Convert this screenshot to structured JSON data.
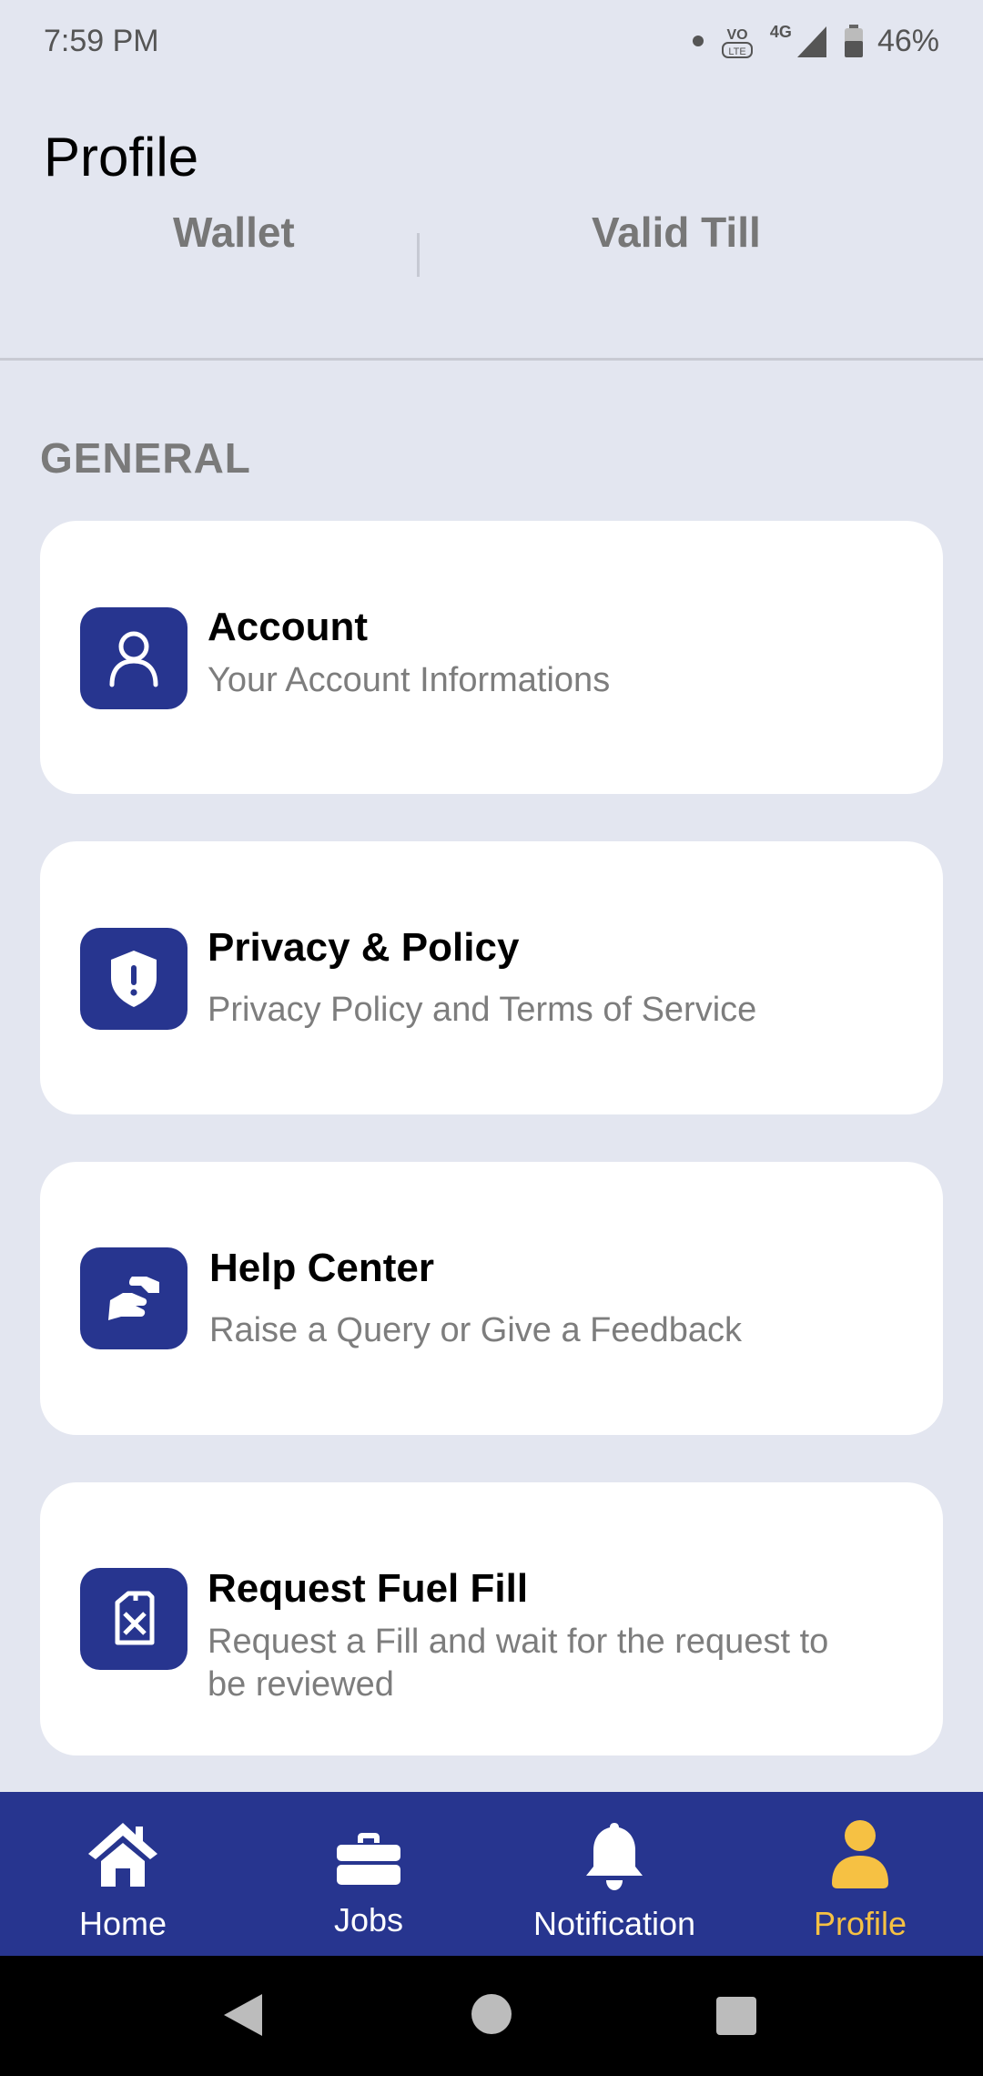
{
  "status_bar": {
    "time": "7:59 PM",
    "network": "4G",
    "battery": "46%"
  },
  "header": {
    "title": "Profile"
  },
  "stats": {
    "left_label": "Wallet",
    "right_label": "Valid Till"
  },
  "section": {
    "title": "GENERAL"
  },
  "menu": [
    {
      "title": "Account",
      "subtitle": "Your Account Informations",
      "icon": "user-icon"
    },
    {
      "title": "Privacy & Policy",
      "subtitle": "Privacy Policy and Terms of Service",
      "icon": "shield-alert-icon"
    },
    {
      "title": "Help Center",
      "subtitle": "Raise a Query or Give a Feedback",
      "icon": "handshake-icon"
    },
    {
      "title": "Request Fuel Fill",
      "subtitle": "Request a Fill and wait for the request to be reviewed",
      "icon": "fuel-can-icon"
    }
  ],
  "bottom_nav": [
    {
      "label": "Home",
      "icon": "home-icon",
      "active": false
    },
    {
      "label": "Jobs",
      "icon": "briefcase-icon",
      "active": false
    },
    {
      "label": "Notification",
      "icon": "bell-icon",
      "active": false
    },
    {
      "label": "Profile",
      "icon": "person-icon",
      "active": true
    }
  ],
  "colors": {
    "background": "#e3e6f0",
    "brand": "#27358f",
    "active_tab": "#f6c143",
    "card": "#ffffff"
  }
}
